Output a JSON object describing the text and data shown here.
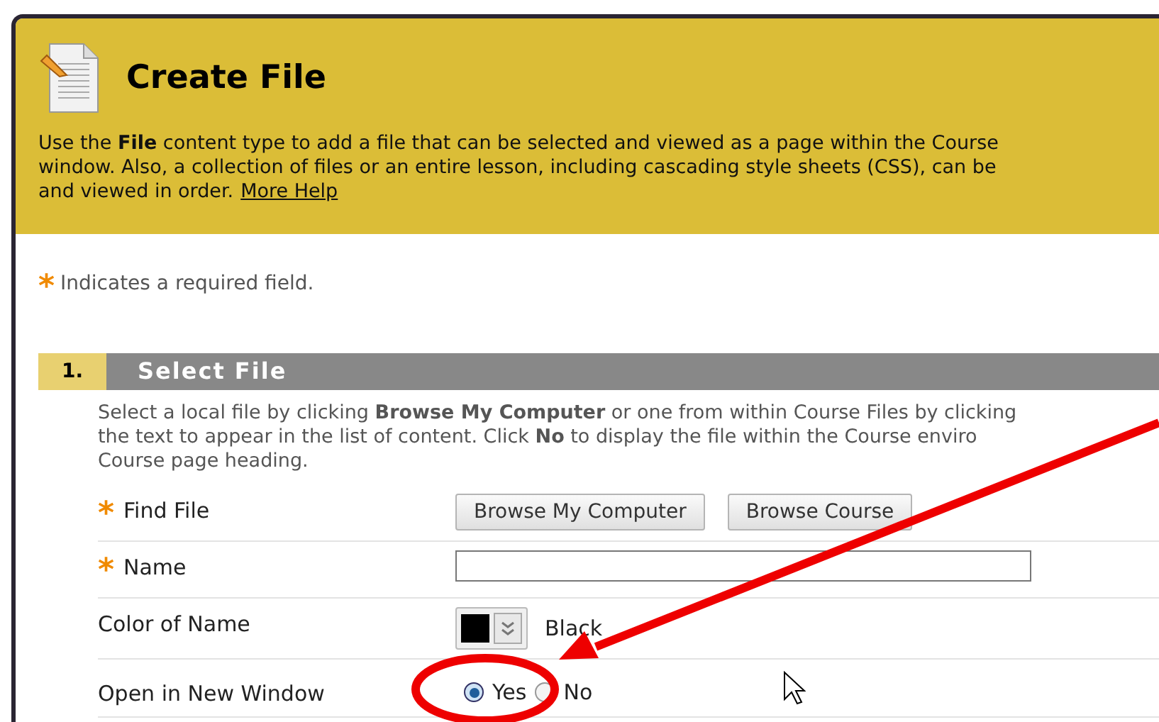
{
  "header": {
    "title": "Create File",
    "description_lines": [
      "Use the **File** content type to add a file that can be selected and viewed as a page within the Course",
      "window. Also, a collection of files or an entire lesson, including cascading style sheets (CSS), can be",
      "and viewed in order."
    ],
    "help_link": "More Help"
  },
  "required_note": {
    "marker": "*",
    "text": "Indicates a required field."
  },
  "section": {
    "number": "1.",
    "title": "Select File",
    "instruction_lines": [
      "Select a local file by clicking **Browse My Computer** or one from within Course Files by clicking",
      "the text to appear in the list of content. Click **No** to display the file within the Course enviro",
      "Course page heading."
    ],
    "fields": [
      {
        "kind": "buttons",
        "label": "Find File",
        "required": true,
        "buttons": [
          "Browse My Computer",
          "Browse Course"
        ]
      },
      {
        "kind": "text",
        "label": "Name",
        "required": true
      },
      {
        "kind": "color",
        "label": "Color of Name",
        "required": false,
        "color": "#000000",
        "value": "Black"
      },
      {
        "kind": "radio",
        "label": "Open in New Window",
        "required": false,
        "options": [
          {
            "label": "Yes",
            "selected": true
          },
          {
            "label": "No",
            "selected": false
          }
        ]
      }
    ]
  }
}
